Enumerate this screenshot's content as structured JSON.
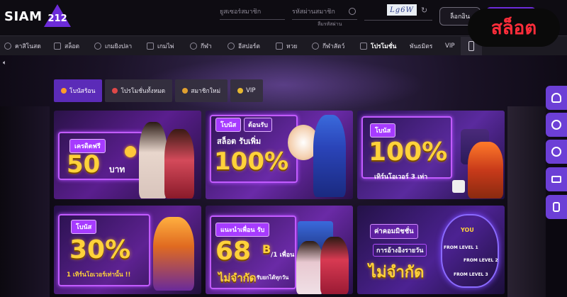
{
  "brand": {
    "logo_text": "SIAM",
    "logo_mark": "212"
  },
  "badge": {
    "text": "สล็อต",
    "color": "#ff2d3a"
  },
  "login": {
    "username_placeholder": "ยูสเซอร์สมาชิก",
    "password_placeholder": "รหัสผ่านสมาชิก",
    "forgot_label": "ลืมรหัสผ่าน",
    "captcha_text": "Lg6W",
    "login_button": "ล็อกอิน"
  },
  "nav": {
    "items": [
      {
        "label": "คาสิโนสด",
        "icon": "casino-icon"
      },
      {
        "label": "สล็อต",
        "icon": "slot-icon"
      },
      {
        "label": "เกมยิงปลา",
        "icon": "fish-icon"
      },
      {
        "label": "เกมไพ่",
        "icon": "cards-icon"
      },
      {
        "label": "กีฬา",
        "icon": "sport-icon"
      },
      {
        "label": "อีสปอร์ต",
        "icon": "esport-icon"
      },
      {
        "label": "หวย",
        "icon": "lottery-icon"
      },
      {
        "label": "กีฬาสัตว์",
        "icon": "animal-icon"
      },
      {
        "label": "โปรโมชั่น",
        "icon": "gift-icon"
      },
      {
        "label": "พันธมิตร",
        "icon": ""
      },
      {
        "label": "VIP",
        "icon": ""
      }
    ]
  },
  "tabs": [
    {
      "label": "โบนัสร้อน"
    },
    {
      "label": "โปรโมชั่นทั้งหมด"
    },
    {
      "label": "สมาชิกใหม่"
    },
    {
      "label": "VIP"
    }
  ],
  "cards": [
    {
      "tag": "เครดิตฟรี",
      "big": "50",
      "unit": "บาท"
    },
    {
      "tag": "โบนัส",
      "tag2": "ต้อนรับ",
      "line": "สล็อต รับเพิ่ม",
      "big": "100%"
    },
    {
      "tag": "โบนัส",
      "big": "100%",
      "sub": "เทิร์นโอเวอร์ 3 เท่า"
    },
    {
      "tag": "โบนัส",
      "big": "30%",
      "sub": "1 เทิร์นโอเวอร์เท่านั้น !!"
    },
    {
      "tag": "แนะนำเพื่อน รับ",
      "big": "68",
      "unit": "B",
      "per": "/1 เพื่อน",
      "sub": "ไม่จำกัด",
      "sub2": "รับยกได้ทุกวัน"
    },
    {
      "tag": "ค่าคอมมิชชั่น",
      "line": "การอ้างอิงรายวัน",
      "sub": "ไม่จำกัด",
      "you": "YOU",
      "level1": "FROM LEVEL 1",
      "level2": "FROM LEVEL 2",
      "level3": "FROM LEVEL 3"
    }
  ]
}
